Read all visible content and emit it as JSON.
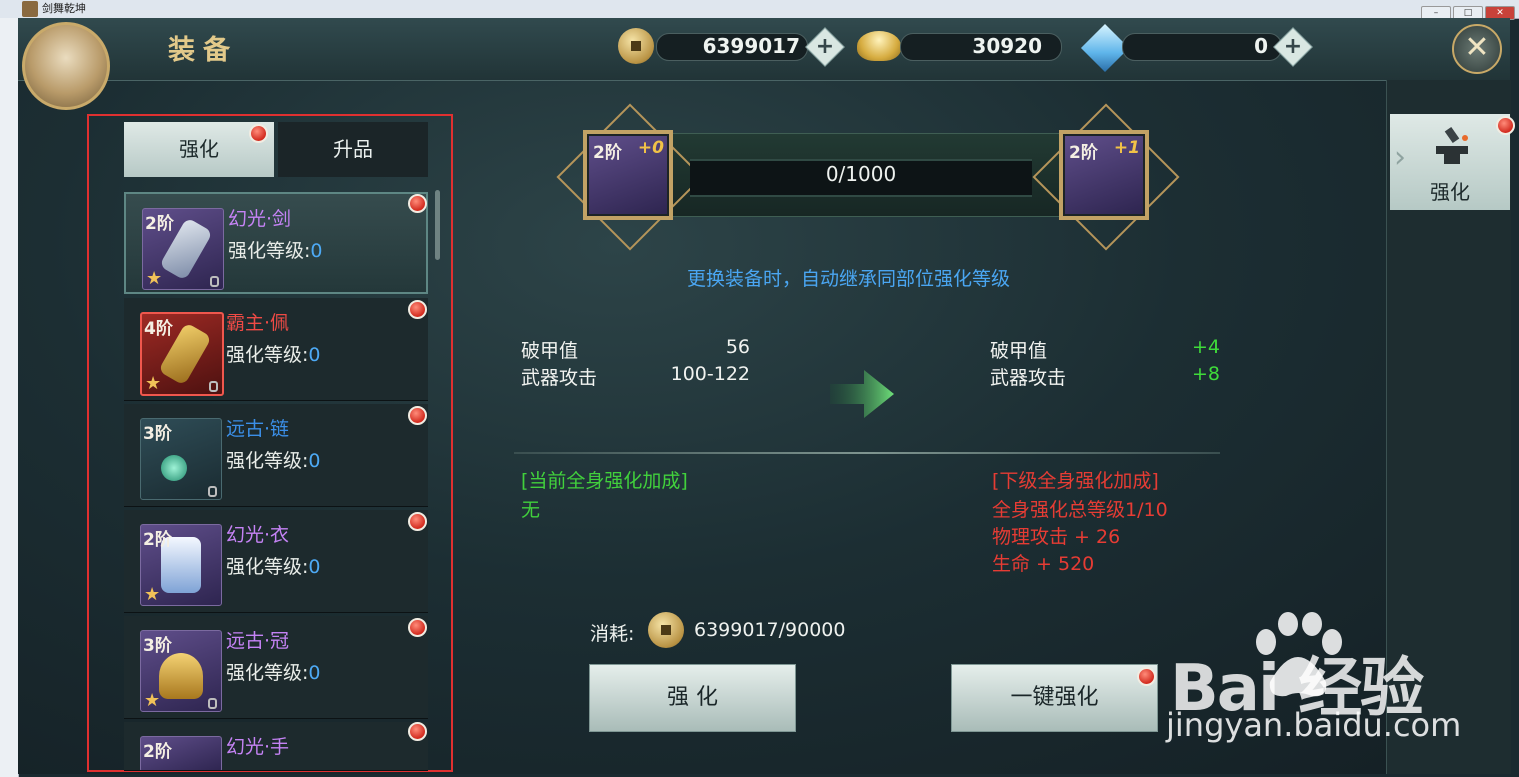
{
  "os": {
    "window_title": "剑舞乾坤",
    "controls": [
      "–",
      "□",
      "✕"
    ]
  },
  "header": {
    "title": "装备",
    "currencies": [
      {
        "name": "copper-coin",
        "value": "6399017"
      },
      {
        "name": "gold-ingot",
        "value": "30920"
      },
      {
        "name": "diamond",
        "value": "0"
      }
    ]
  },
  "tabs": {
    "strengthen": "强化",
    "upgrade": "升品"
  },
  "items": [
    {
      "tier": "2阶",
      "name": "幻光·剑",
      "level_label": "强化等级:",
      "level": "0",
      "color": "#c583f5"
    },
    {
      "tier": "4阶",
      "name": "霸主·佩",
      "level_label": "强化等级:",
      "level": "0",
      "color": "#ee4a45"
    },
    {
      "tier": "3阶",
      "name": "远古·链",
      "level_label": "强化等级:",
      "level": "0",
      "color": "#3b8fe8"
    },
    {
      "tier": "2阶",
      "name": "幻光·衣",
      "level_label": "强化等级:",
      "level": "0",
      "color": "#c583f5"
    },
    {
      "tier": "3阶",
      "name": "远古·冠",
      "level_label": "强化等级:",
      "level": "0",
      "color": "#c583f5"
    },
    {
      "tier": "2阶",
      "name": "幻光·手",
      "color": "#c583f5"
    }
  ],
  "progress": {
    "current_tier": "2阶",
    "current_plus": "+0",
    "next_tier": "2阶",
    "next_plus": "+1",
    "text": "0/1000",
    "fraction": 0.0
  },
  "hint": "更换装备时，自动继承同部位强化等级",
  "stats_current": [
    {
      "label": "破甲值",
      "value": "56"
    },
    {
      "label": "武器攻击",
      "value": "100-122"
    }
  ],
  "stats_next": [
    {
      "label": "破甲值",
      "value": "+4"
    },
    {
      "label": "武器攻击",
      "value": "+8"
    }
  ],
  "bonus_current": {
    "title": "[当前全身强化加成]",
    "lines": [
      "无"
    ]
  },
  "bonus_next": {
    "title": "[下级全身强化加成]",
    "lines": [
      "全身强化总等级1/10",
      "物理攻击 + 26",
      "生命 + 520"
    ]
  },
  "cost": {
    "label": "消耗:",
    "value": "6399017/90000"
  },
  "buttons": {
    "strengthen": "强 化",
    "one_click": "一键强化"
  },
  "side_tab": {
    "label": "强化"
  },
  "watermark": {
    "logo": "Bai  经验",
    "url": "jingyan.baidu.com"
  }
}
